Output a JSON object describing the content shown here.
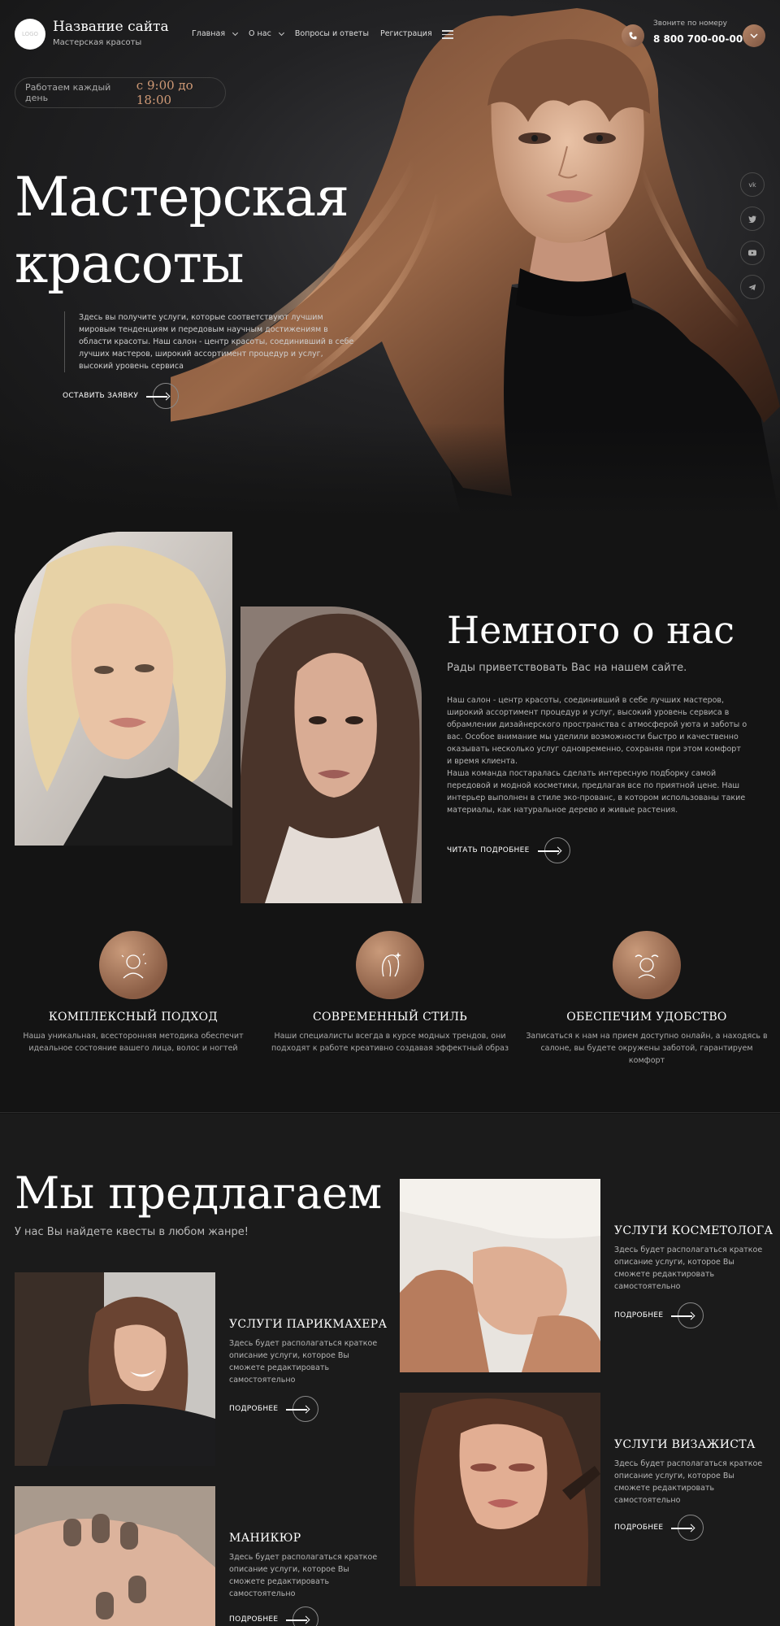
{
  "header": {
    "logo_text": "LOGO",
    "site_name": "Название сайта",
    "site_subtitle": "Мастерская красоты",
    "nav": [
      {
        "label": "Главная",
        "dropdown": true
      },
      {
        "label": "О нас",
        "dropdown": true
      },
      {
        "label": "Вопросы и ответы",
        "dropdown": false
      },
      {
        "label": "Регистрация",
        "dropdown": false
      }
    ],
    "call_label": "Звоните по номеру",
    "phone": "8 800 700-00-00"
  },
  "hours": {
    "label": "Работаем каждый день",
    "time": "с 9:00 до 18:00"
  },
  "hero": {
    "title_line1": "Мастерская",
    "title_line2": "красоты",
    "description": "Здесь вы получите услуги, которые соответствуют лучшим мировым тенденциям и передовым научным достижениям в области красоты. Наш салон - центр красоты, соединивший в себе лучших мастеров, широкий ассортимент процедур и услуг, высокий уровень сервиса",
    "cta_label": "ОСТАВИТЬ ЗАЯВКУ"
  },
  "socials": [
    "vk",
    "twitter",
    "youtube",
    "telegram"
  ],
  "about": {
    "title": "Немного о нас",
    "subtitle": "Рады приветствовать Вас на нашем сайте.",
    "paragraph1": "Наш салон - центр красоты, соединивший в себе лучших мастеров, широкий ассортимент процедур и услуг, высокий уровень сервиса в обрамлении дизайнерского пространства с атмосферой уюта и заботы о вас. Особое внимание мы уделили возможности быстро и качественно оказывать несколько услуг одновременно, сохраняя при этом комфорт и время клиента.",
    "paragraph2": "Наша команда постаралась сделать интересную подборку самой передовой и модной косметики, предлагая все по приятной цене. Наш интерьер выполнен в стиле эко-прованс, в котором использованы такие материалы, как натуральное дерево и живые растения.",
    "read_more": "ЧИТАТЬ ПОДРОБНЕЕ"
  },
  "features": [
    {
      "icon": "face-care-icon",
      "title": "КОМПЛЕКСНЫЙ ПОДХОД",
      "text": "Наша уникальная, всесторонняя методика обеспечит идеальное состояние вашего лица, волос и ногтей"
    },
    {
      "icon": "hair-style-icon",
      "title": "СОВРЕМЕННЫЙ СТИЛЬ",
      "text": "Наши специалисты всегда в курсе модных трендов, они подходят к работе креативно создавая эффектный образ"
    },
    {
      "icon": "comfort-icon",
      "title": "ОБЕСПЕЧИМ УДОБСТВО",
      "text": "Записаться к нам на прием доступно онлайн, а находясь в салоне, вы будете окружены заботой, гарантируем комфорт"
    }
  ],
  "services": {
    "title": "Мы предлагаем",
    "subtitle": "У нас Вы найдете квесты в любом жанре!",
    "items": [
      {
        "title": "УСЛУГИ ПАРИКМАХЕРА",
        "text": "Здесь будет располагаться краткое описание услуги, которое Вы сможете редактировать самостоятельно",
        "more": "ПОДРОБНЕЕ"
      },
      {
        "title": "МАНИКЮР",
        "text": "Здесь будет располагаться краткое описание услуги, которое Вы сможете редактировать самостоятельно",
        "more": "ПОДРОБНЕЕ"
      },
      {
        "title": "УСЛУГИ КОСМЕТОЛОГА",
        "text": "Здесь будет располагаться краткое описание услуги, которое Вы сможете редактировать самостоятельно",
        "more": "ПОДРОБНЕЕ"
      },
      {
        "title": "УСЛУГИ ВИЗАЖИСТА",
        "text": "Здесь будет располагаться краткое описание услуги, которое Вы сможете редактировать самостоятельно",
        "more": "ПОДРОБНЕЕ"
      }
    ]
  },
  "colors": {
    "accent": "#c08d6d",
    "accent_dark": "#7d5541",
    "background": "#141414",
    "background_alt": "#1b1b1b"
  }
}
